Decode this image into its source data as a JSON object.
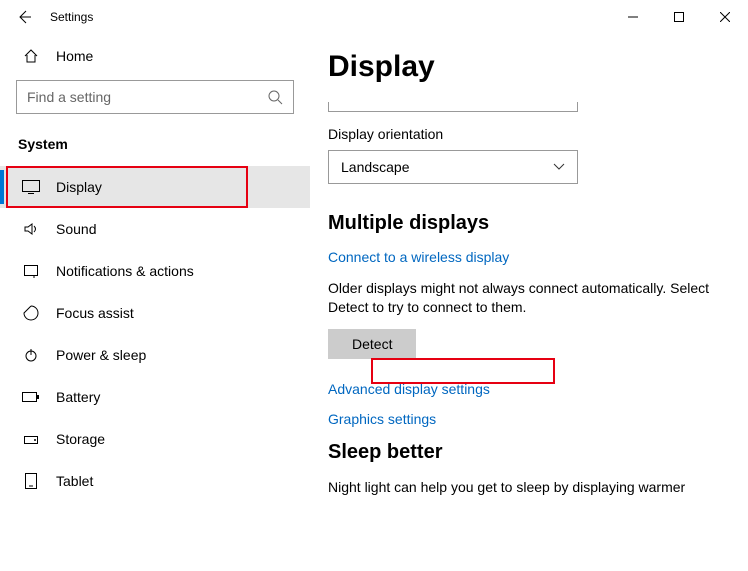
{
  "titlebar": {
    "title": "Settings"
  },
  "sidebar": {
    "home": "Home",
    "search_placeholder": "Find a setting",
    "category": "System",
    "items": [
      {
        "label": "Display"
      },
      {
        "label": "Sound"
      },
      {
        "label": "Notifications & actions"
      },
      {
        "label": "Focus assist"
      },
      {
        "label": "Power & sleep"
      },
      {
        "label": "Battery"
      },
      {
        "label": "Storage"
      },
      {
        "label": "Tablet"
      }
    ]
  },
  "main": {
    "heading": "Display",
    "orientation_label": "Display orientation",
    "orientation_value": "Landscape",
    "multi_heading": "Multiple displays",
    "wireless_link": "Connect to a wireless display",
    "detect_help": "Older displays might not always connect automatically. Select Detect to try to connect to them.",
    "detect_btn": "Detect",
    "adv_link": "Advanced display settings",
    "gfx_link": "Graphics settings",
    "sleep_heading": "Sleep better",
    "sleep_text": "Night light can help you get to sleep by displaying warmer"
  }
}
